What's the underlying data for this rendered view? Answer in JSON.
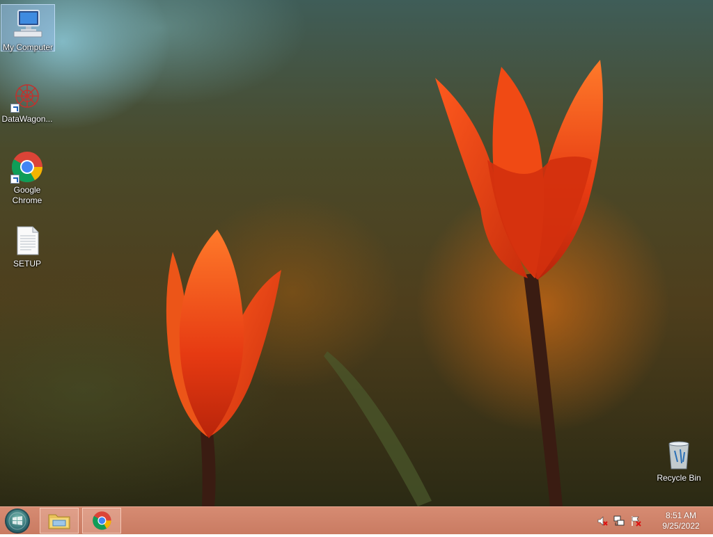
{
  "desktop": {
    "icons": [
      {
        "label": "My Computer"
      },
      {
        "label": "DataWagon..."
      },
      {
        "label": "Google\nChrome"
      },
      {
        "label": "SETUP"
      },
      {
        "label": "Recycle Bin"
      }
    ]
  },
  "taskbar": {
    "pinned": [
      {
        "icon": "file-explorer-icon"
      },
      {
        "icon": "chrome-icon"
      }
    ],
    "tray": {
      "icons": [
        "volume-muted-icon",
        "network-icon",
        "action-center-icon"
      ]
    },
    "clock": {
      "time": "8:51 AM",
      "date": "9/25/2022"
    }
  },
  "colors": {
    "taskbar": "#c97b62",
    "selection": "#96bee6"
  }
}
